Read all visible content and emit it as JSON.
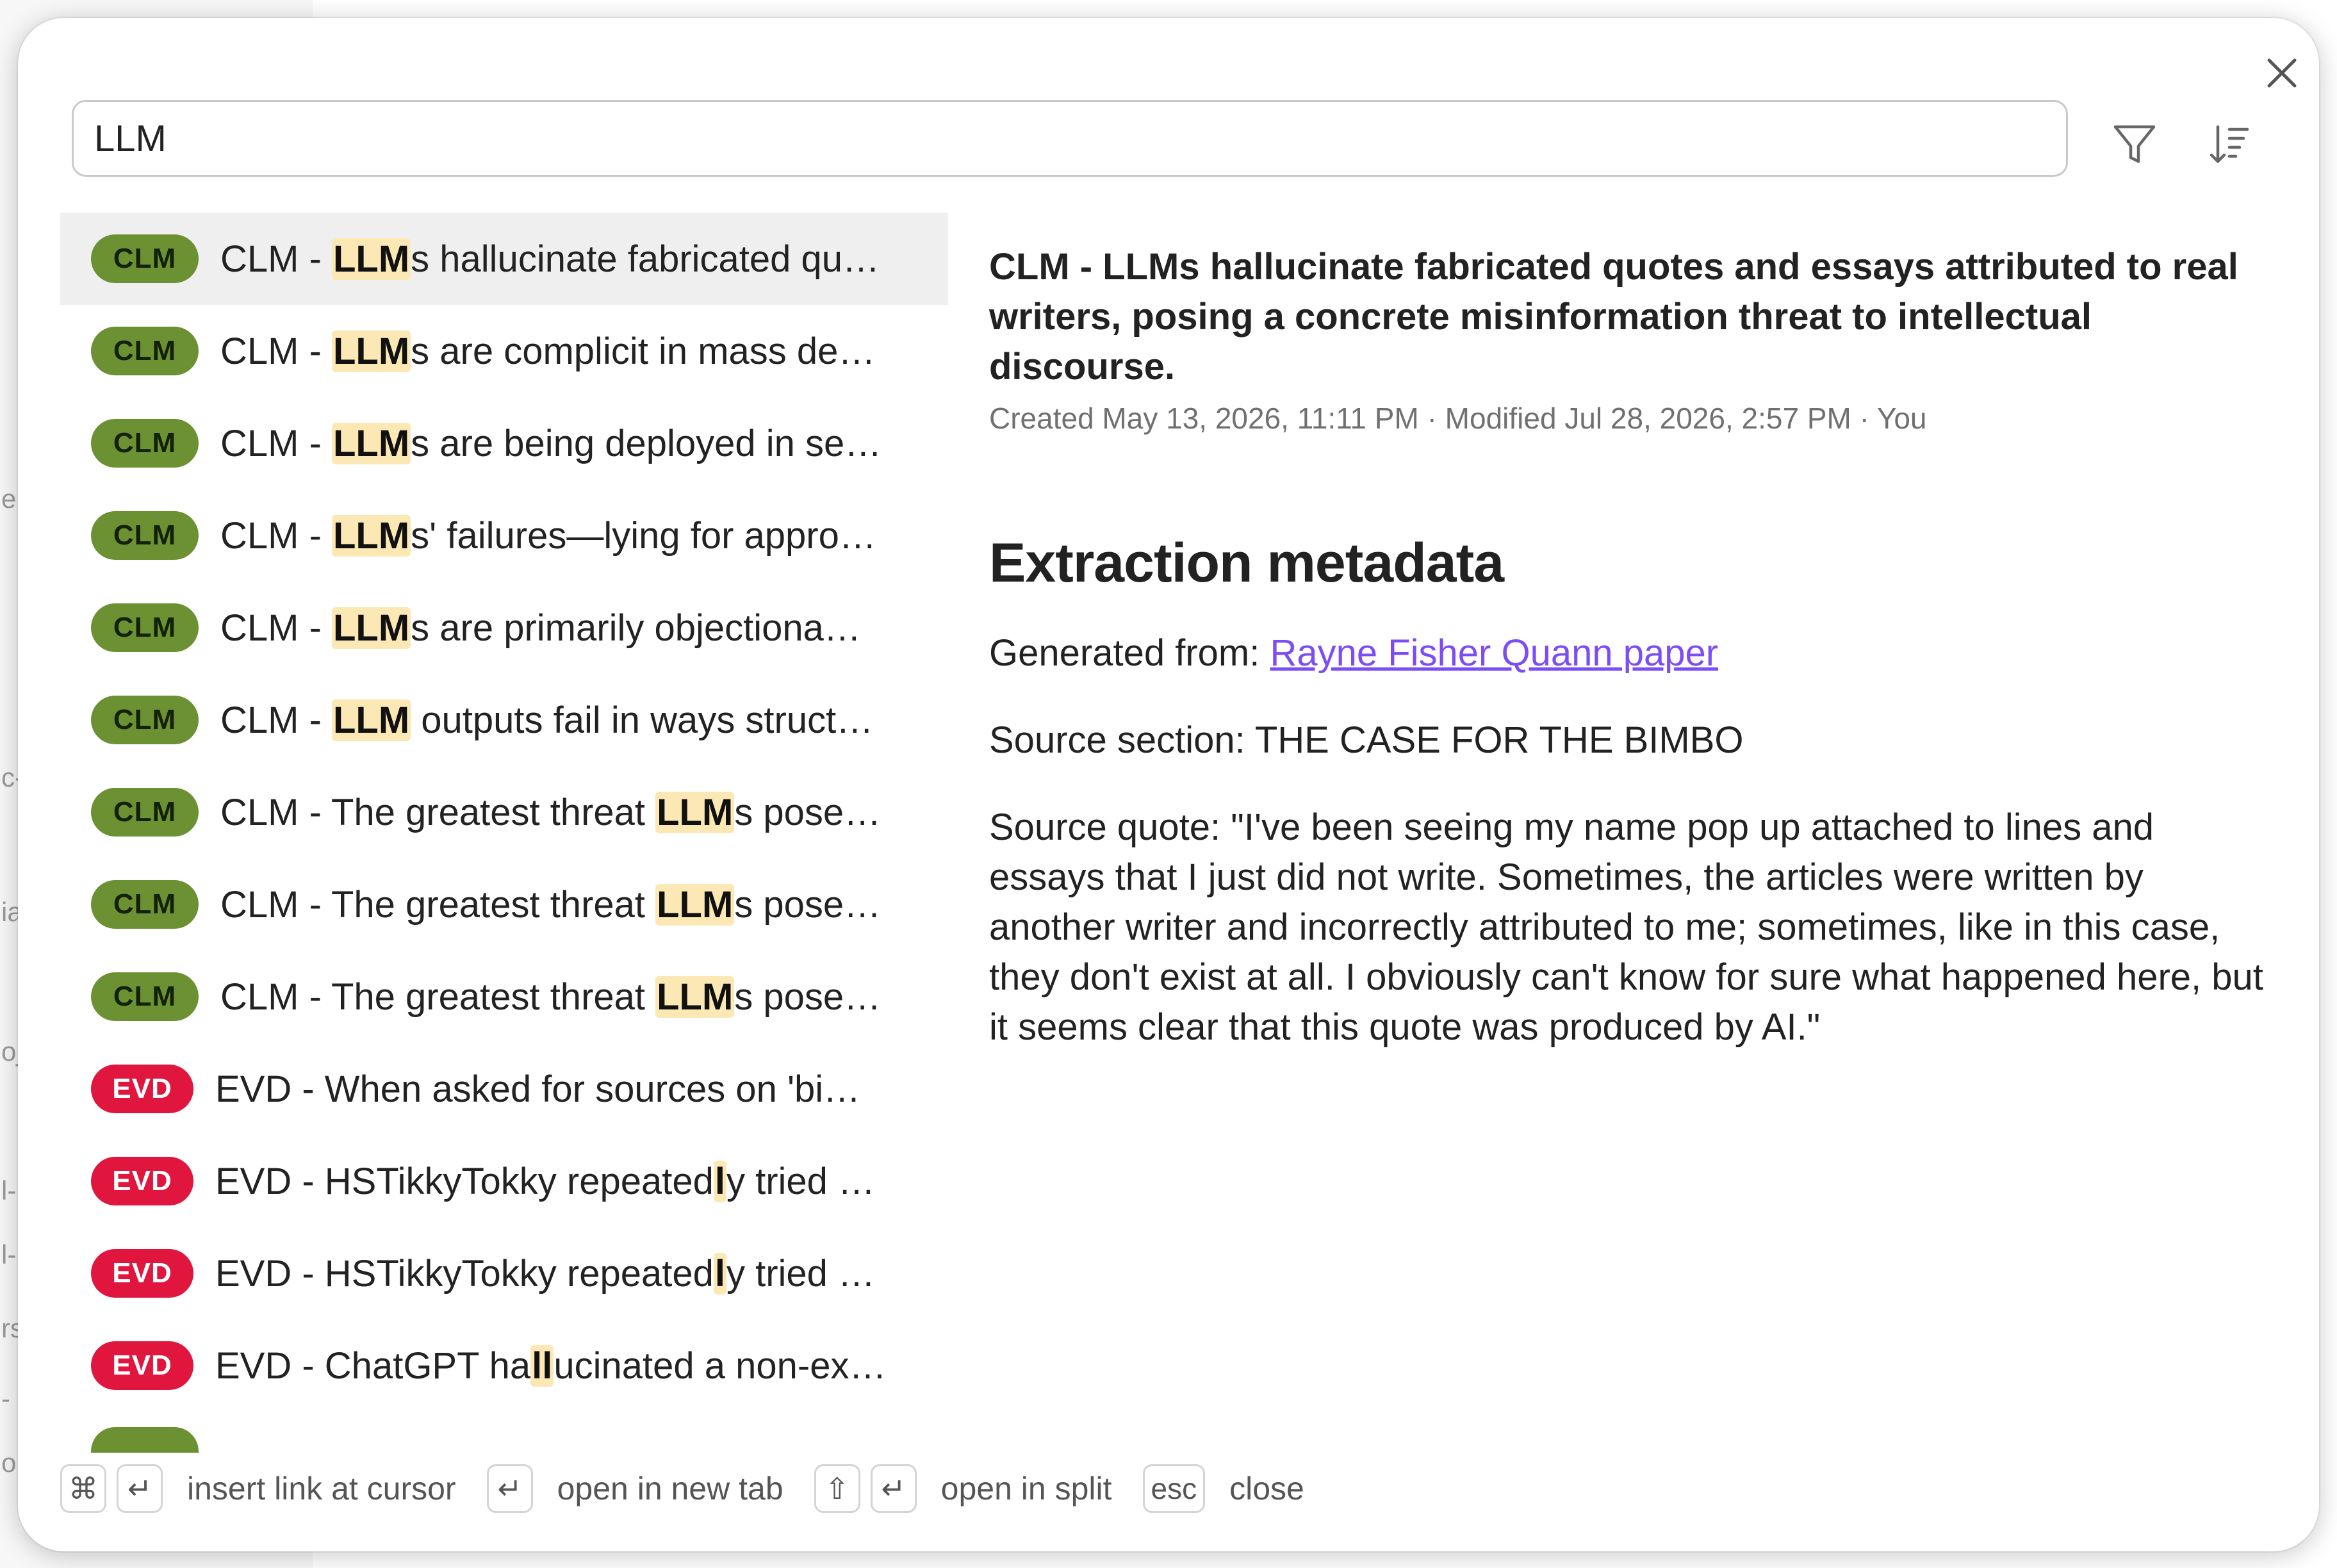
{
  "search": {
    "query": "LLM"
  },
  "results": [
    {
      "type": "CLM",
      "pre": "CLM - ",
      "match": "LLM",
      "post": "s hallucinate fabricated qu…"
    },
    {
      "type": "CLM",
      "pre": "CLM - ",
      "match": "LLM",
      "post": "s are complicit in mass de…"
    },
    {
      "type": "CLM",
      "pre": "CLM - ",
      "match": "LLM",
      "post": "s are being deployed in se…"
    },
    {
      "type": "CLM",
      "pre": "CLM - ",
      "match": "LLM",
      "post": "s' failures—lying for appro…"
    },
    {
      "type": "CLM",
      "pre": "CLM - ",
      "match": "LLM",
      "post": "s are primarily objectiona…"
    },
    {
      "type": "CLM",
      "pre": "CLM - ",
      "match": "LLM",
      "post": " outputs fail in ways struct…"
    },
    {
      "type": "CLM",
      "pre": "CLM - The greatest threat ",
      "match": "LLM",
      "post": "s pose…"
    },
    {
      "type": "CLM",
      "pre": "CLM - The greatest threat ",
      "match": "LLM",
      "post": "s pose…"
    },
    {
      "type": "CLM",
      "pre": "CLM - The greatest threat ",
      "match": "LLM",
      "post": "s pose…"
    },
    {
      "type": "EVD",
      "pre": "EVD - When asked for sources on 'bi…",
      "match": "",
      "post": ""
    },
    {
      "type": "EVD",
      "pre": "EVD - HSTikkyTokky repeated",
      "match": "l",
      "post": "y tried …"
    },
    {
      "type": "EVD",
      "pre": "EVD - HSTikkyTokky repeated",
      "match": "l",
      "post": "y tried …"
    },
    {
      "type": "EVD",
      "pre": "EVD - ChatGPT ha",
      "match": "ll",
      "post": "ucinated a non-ex…"
    }
  ],
  "preview": {
    "title": "CLM - LLMs hallucinate fabricated quotes and essays attributed to real writers, posing a concrete misinformation threat to intellectual discourse.",
    "meta": "Created May 13, 2026, 11:11 PM · Modified Jul 28, 2026, 2:57 PM · You",
    "heading": "Extraction metadata",
    "generated_label": "Generated from: ",
    "generated_link": "Rayne Fisher Quann paper",
    "source_section": "Source section: THE CASE FOR THE BIMBO",
    "source_quote": "Source quote: \"I've been seeing my name pop up attached to lines and essays that I just did not write. Sometimes, the articles were written by another writer and incorrectly attributed to me; sometimes, like in this case, they don't exist at all. I obviously can't know for sure what happened here, but it seems clear that this quote was produced by AI.\""
  },
  "footer": {
    "cmd_key": "⌘",
    "enter_key": "↵",
    "shift_key": "⇧",
    "esc_key": "esc",
    "insert_link": "insert link at cursor",
    "new_tab": "open in new tab",
    "split": "open in split",
    "close": "close"
  },
  "background_fragments": [
    "e",
    "c-",
    "ia",
    "oj",
    "l-",
    "l-",
    "rs",
    "-",
    "ob"
  ],
  "colors": {
    "clm": "#6b9133",
    "evd": "#e0163f",
    "highlight": "#fbe8b4",
    "link": "#7c4cf5"
  },
  "icons": [
    "close-icon",
    "filter-icon",
    "sort-icon"
  ]
}
